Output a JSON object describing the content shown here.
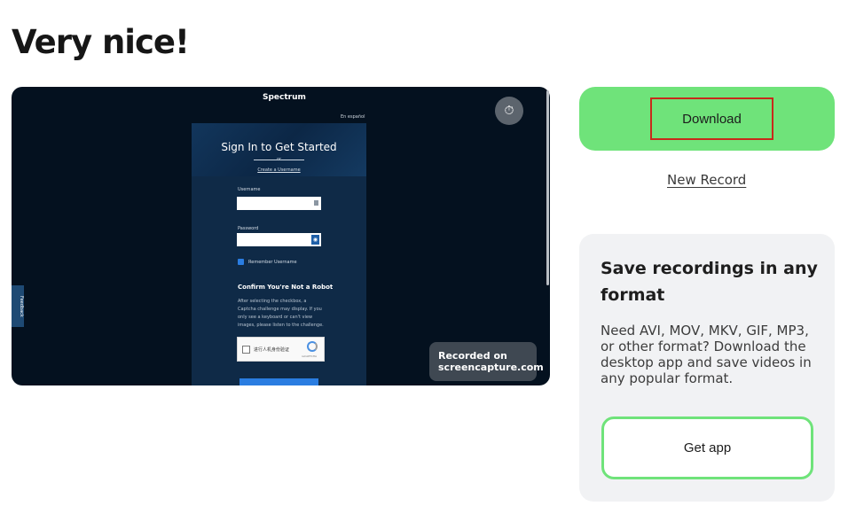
{
  "page": {
    "title": "Very nice!"
  },
  "preview": {
    "brand": "Spectrum",
    "language": "En español",
    "signin_title": "Sign In to Get Started",
    "or_text": "or",
    "create_link": "Create a Username",
    "username_label": "Username",
    "password_label": "Password",
    "remember_label": "Remember Username",
    "robot_title": "Confirm You're Not a Robot",
    "robot_text": "After selecting the checkbox, a Captcha challenge may display. If you only see a keyboard or can't view images, please listen to the challenge.",
    "captcha_label": "进行人机身份验证",
    "captcha_small": "reCAPTCHA",
    "feedback_label": "Feedback",
    "recorded_line1": "Recorded on",
    "recorded_line2": "screencapture.com",
    "timer_icon": "timer-icon"
  },
  "actions": {
    "download_label": "Download",
    "new_record_label": "New Record"
  },
  "promo": {
    "title": "Save recordings in any format",
    "body": "Need AVI, MOV, MKV, GIF, MP3, or other format? Download the desktop app and save videos in any popular format.",
    "button_label": "Get app"
  },
  "colors": {
    "accent_green": "#6fe37a",
    "highlight_red": "#c82a1b",
    "preview_bg": "#04111f"
  }
}
